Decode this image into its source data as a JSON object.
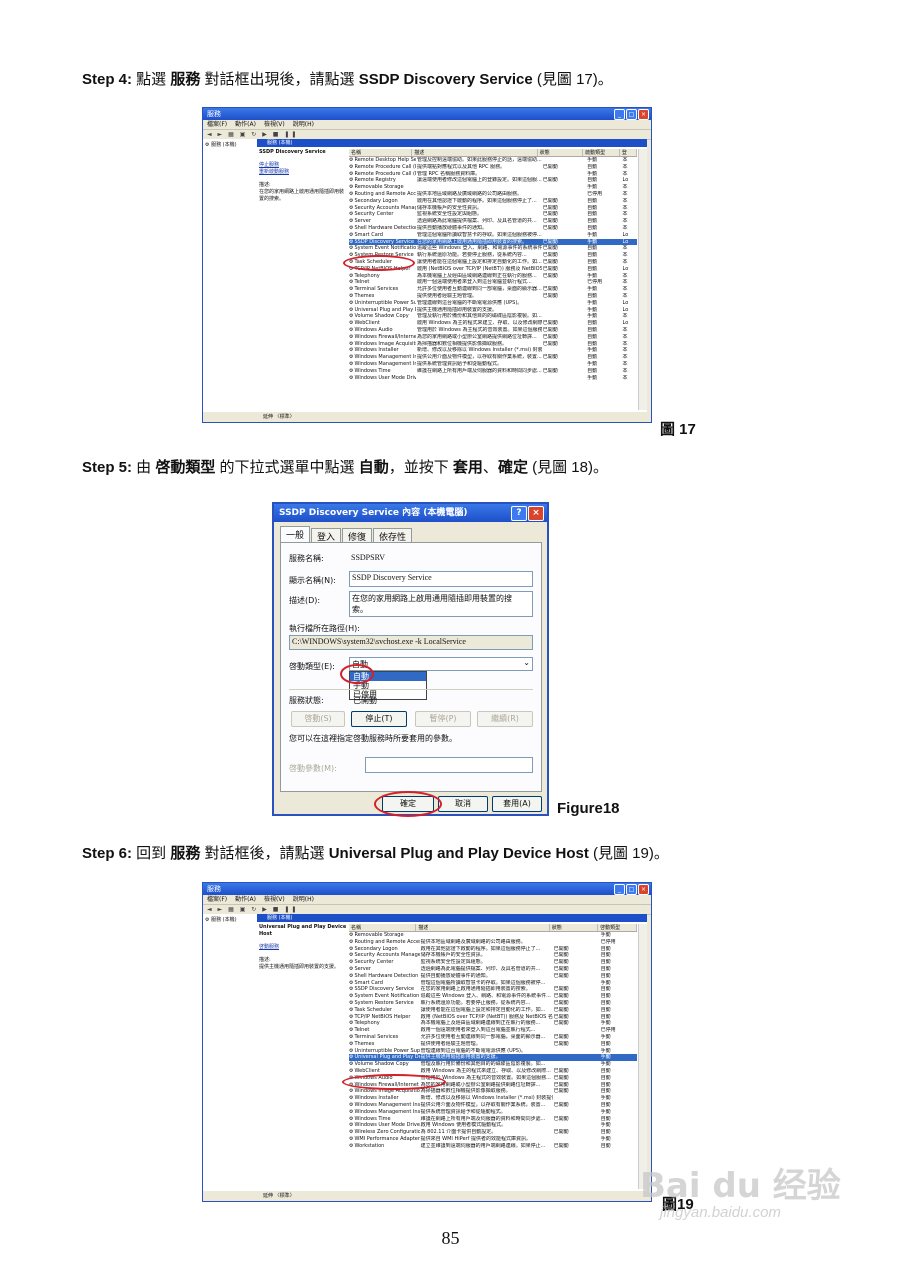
{
  "step4": {
    "prefix": "Step 4:",
    "t1": " 點選 ",
    "b1": "服務",
    "t2": " 對話框出現後，請點選 ",
    "b2": "SSDP Discovery Service",
    "t3": " (見圖 17)。"
  },
  "step5": {
    "prefix": "Step 5:",
    "t1": " 由 ",
    "b1": "啓動類型",
    "t2": " 的下拉式選單中點選 ",
    "b2": "自動",
    "t3": "，並按下 ",
    "b3": "套用",
    "t4": "、",
    "b4": "確定",
    "t5": " (見圖 18)。"
  },
  "step6": {
    "prefix": "Step 6:",
    "t1": " 回到 ",
    "b1": "服務",
    "t2": " 對話框後，請點選 ",
    "b2": "Universal Plug and Play Device Host",
    "t3": " (見圖 19)。"
  },
  "captions": {
    "fig17": "圖 17",
    "fig18": "Figure18",
    "fig19": "圖19"
  },
  "page_number": "85",
  "watermark": {
    "brand": "Bai du 经验",
    "url": "jingyan.baidu.com"
  },
  "win1": {
    "title": "服務",
    "menu": [
      "檔案(F)",
      "動作(A)",
      "檢視(V)",
      "說明(H)"
    ],
    "tree_item": "服務 (本機)",
    "pane_header": "服務 (本機)",
    "desc_title": "SSDP Discovery Service",
    "desc_links": [
      "停止服務",
      "重新啟動服務"
    ],
    "desc_label": "描述:",
    "desc_text": "在您的家用網路上啟用通用隨插即用裝置的搜索。",
    "columns": [
      "名稱",
      "描述",
      "狀態",
      "啟動類型",
      "登"
    ],
    "rows": [
      [
        "Remote Desktop Help Sess...",
        "管理及控制遠端協助。如果此服務停止的話，遠端協助...",
        "",
        "手動",
        "本"
      ],
      [
        "Remote Procedure Call (R...",
        "提供端點對應程式以及其他 RPC 服務。",
        "已開動",
        "自動",
        "本"
      ],
      [
        "Remote Procedure Call (R...",
        "管理 RPC 名稱服務資料庫。",
        "",
        "手動",
        "本"
      ],
      [
        "Remote Registry",
        "讓遠端使用者修改這個電腦上的登錄設定。如果這個服...",
        "已開動",
        "自動",
        "Lo"
      ],
      [
        "Removable Storage",
        "",
        "",
        "手動",
        "本"
      ],
      [
        "Routing and Remote Access",
        "提供本地區域網路及廣域網路的公司路由服務。",
        "",
        "已停用",
        "本"
      ],
      [
        "Secondary Logon",
        "啟用在其他認證下啟動的程序。如果這個服務停止了...",
        "已開動",
        "自動",
        "本"
      ],
      [
        "Security Accounts Manager",
        "儲存本機帳戶的安全性資訊。",
        "已開動",
        "自動",
        "本"
      ],
      [
        "Security Center",
        "監視系統安全性設定與組態。",
        "已開動",
        "自動",
        "本"
      ],
      [
        "Server",
        "透過網路為此電腦提供檔案、列印、及具名管道的共...",
        "已開動",
        "自動",
        "本"
      ],
      [
        "Shell Hardware Detection",
        "提供自動播放硬體事件的通知。",
        "已開動",
        "自動",
        "本"
      ],
      [
        "Smart Card",
        "管理這個電腦所讀取智慧卡的存取。如果這個服務被停...",
        "",
        "手動",
        "Lo"
      ],
      [
        "SSDP Discovery Service",
        "在您的家用網路上啟用通用隨插即用裝置的搜索。",
        "已開動",
        "手動",
        "Lo"
      ],
      [
        "System Event Notification",
        "追蹤這些 Windows 登入、網路、和電源事件的系統事件...",
        "已開動",
        "自動",
        "本"
      ],
      [
        "System Restore Service",
        "執行系統還原功能。若要停止服務，從系統內容...",
        "已開動",
        "自動",
        "本"
      ],
      [
        "Task Scheduler",
        "讓使用者能在這個電腦上設定和排定自動化的工作。如...",
        "已開動",
        "自動",
        "本"
      ],
      [
        "TCP/IP NetBIOS Helper",
        "啟用 (NetBIOS over TCP/IP (NetBT)) 服務及 NetBIOS 名稱...",
        "已開動",
        "自動",
        "Lo"
      ],
      [
        "Telephony",
        "為本機電腦上及經由區域網路連線到正在執行的服務...",
        "已開動",
        "手動",
        "本"
      ],
      [
        "Telnet",
        "啟用一個遠端使用者來登入到這台電腦並執行程式...",
        "",
        "已停用",
        "本"
      ],
      [
        "Terminal Services",
        "允許多位使用者互動連線到同一部電腦，桌面的顯示器...",
        "已開動",
        "手動",
        "本"
      ],
      [
        "Themes",
        "提供使用者經驗主題管理。",
        "已開動",
        "自動",
        "本"
      ],
      [
        "Uninterruptible Power Sup...",
        "管理連線到這台電腦的不斷電電源供應 (UPS)。",
        "",
        "手動",
        "Lo"
      ],
      [
        "Universal Plug and Play D...",
        "提供主機通用隨插即用裝置的支援。",
        "",
        "手動",
        "Lo"
      ],
      [
        "Volume Shadow Copy",
        "管理及執行用於備份和其他目的的磁碟區陰影複製。如...",
        "",
        "手動",
        "本"
      ],
      [
        "WebClient",
        "啟用 Windows 為主的程式來建立、存取、以及修改網際...",
        "已開動",
        "自動",
        "Lo"
      ],
      [
        "Windows Audio",
        "管理用於 Windows 為主程式的音效裝置。如果這個服務...",
        "已開動",
        "自動",
        "本"
      ],
      [
        "Windows Firewall/Internet...",
        "為您的家用網路或小型辦公室網路提供網路位址轉譯...",
        "已開動",
        "自動",
        "本"
      ],
      [
        "Windows Image Acquisiti...",
        "為掃描器和數位相機提供影像擷取服務。",
        "已開動",
        "自動",
        "本"
      ],
      [
        "Windows Installer",
        "新增、修改以及移除以 Windows Installer (*.msi) 封裝提供...",
        "",
        "手動",
        "本"
      ],
      [
        "Windows Management Ins...",
        "提供公用介面及物件模型，以存取有關作業系統，裝置...",
        "已開動",
        "自動",
        "本"
      ],
      [
        "Windows Management Ins...",
        "提供系統管理資訊給予和從驅動程式。",
        "",
        "手動",
        "本"
      ],
      [
        "Windows Time",
        "維護在網路上所有用戶端及伺服器的資料和時間同步處...",
        "已開動",
        "自動",
        "本"
      ],
      [
        "Windows User Mode Drive...",
        "",
        "",
        "手動",
        "本"
      ]
    ],
    "status_tabs": "延伸 〈標準〉"
  },
  "dialog": {
    "title": "SSDP Discovery Service 內容 (本機電腦)",
    "tabs": [
      "一般",
      "登入",
      "修復",
      "依存性"
    ],
    "service_name_label": "服務名稱:",
    "service_name": "SSDPSRV",
    "display_name_label": "顯示名稱(N):",
    "display_name": "SSDP Discovery Service",
    "description_label": "描述(D):",
    "description": "在您的家用網路上啟用通用隨插即用裝置的搜索。",
    "exe_path_label": "執行檔所在路徑(H):",
    "exe_path": "C:\\WINDOWS\\system32\\svchost.exe -k LocalService",
    "startup_label": "啓動類型(E):",
    "startup_value": "自動",
    "startup_options": [
      "自動",
      "手動",
      "已停用"
    ],
    "status_label": "服務狀態:",
    "status_value": "已開動",
    "buttons": [
      "啓動(S)",
      "停止(T)",
      "暫停(P)",
      "繼續(R)"
    ],
    "hint": "您可以在這裡指定啓動服務時所要套用的參數。",
    "params_label": "啓動參數(M):",
    "ok": "確定",
    "cancel": "取消",
    "apply": "套用(A)"
  },
  "win2": {
    "title": "服務",
    "menu": [
      "檔案(F)",
      "動作(A)",
      "檢視(V)",
      "說明(H)"
    ],
    "tree_item": "服務 (本機)",
    "pane_header": "服務 (本機)",
    "desc_title": "Universal Plug and Play Device Host",
    "desc_links": [
      "啓動服務"
    ],
    "desc_label": "描述:",
    "desc_text": "提供主機通用隨插即用裝置的支援。",
    "columns": [
      "名稱",
      "描述",
      "狀態",
      "啓動類型"
    ],
    "rows": [
      [
        "Removable Storage",
        "",
        "",
        "手動"
      ],
      [
        "Routing and Remote Access",
        "提供本地區域網路及廣域網路的公司路由服務。",
        "",
        "已停用"
      ],
      [
        "Secondary Logon",
        "啟用在其他認證下啟動的程序。如果這個服務停止了...",
        "已開動",
        "自動"
      ],
      [
        "Security Accounts Manager",
        "儲存本機帳戶的安全性資訊。",
        "已開動",
        "自動"
      ],
      [
        "Security Center",
        "監視系統安全性設定與組態。",
        "已開動",
        "自動"
      ],
      [
        "Server",
        "透過網路為此電腦提供檔案、列印、及具名管道的共...",
        "已開動",
        "自動"
      ],
      [
        "Shell Hardware Detection",
        "提供自動播放硬體事件的通知。",
        "已開動",
        "自動"
      ],
      [
        "Smart Card",
        "管理這個電腦所讀取智慧卡的存取。如果這個服務被停...",
        "",
        "手動"
      ],
      [
        "SSDP Discovery Service",
        "在您的家用網路上啟用通用隨插即用裝置的搜索。",
        "已開動",
        "自動"
      ],
      [
        "System Event Notification",
        "追蹤這些 Windows 登入、網路、和電源事件的系統事件...",
        "已開動",
        "自動"
      ],
      [
        "System Restore Service",
        "執行系統還原功能。若要停止服務，從系統內容...",
        "已開動",
        "自動"
      ],
      [
        "Task Scheduler",
        "讓使用者能在這個電腦上設定和排定自動化的工作。如...",
        "已開動",
        "自動"
      ],
      [
        "TCP/IP NetBIOS Helper",
        "啟用 (NetBIOS over TCP/IP (NetBT)) 服務及 NetBIOS 名稱...",
        "已開動",
        "自動"
      ],
      [
        "Telephony",
        "為本機電腦上及經由區域網路連線到正在執行的服務...",
        "已開動",
        "手動"
      ],
      [
        "Telnet",
        "啟用一個遠端使用者來登入到這台電腦並執行程式...",
        "",
        "已停用"
      ],
      [
        "Terminal Services",
        "允許多位使用者互動連線到同一部電腦，桌面的顯示器...",
        "已開動",
        "手動"
      ],
      [
        "Themes",
        "提供使用者經驗主題管理。",
        "已開動",
        "自動"
      ],
      [
        "Uninterruptible Power Supply",
        "管理連線到這台電腦的不斷電電源供應 (UPS)。",
        "",
        "手動"
      ],
      [
        "Universal Plug and Play Device Host",
        "提供主機通用隨插即用裝置的支援。",
        "",
        "手動"
      ],
      [
        "Volume Shadow Copy",
        "管理及執行用於備份和其他目的的磁碟區陰影複製。如...",
        "",
        "手動"
      ],
      [
        "WebClient",
        "啟用 Windows 為主的程式來建立、存取、以及修改網際...",
        "已開動",
        "自動"
      ],
      [
        "Windows Audio",
        "管理用於 Windows 為主程式的音效裝置。如果這個服務...",
        "已開動",
        "自動"
      ],
      [
        "Windows Firewall/Internet Connection ...",
        "為您的家用網路或小型辦公室網路提供網路位址轉譯...",
        "已開動",
        "自動"
      ],
      [
        "Windows Image Acquisition (WIA)",
        "為掃描器和數位相機提供影像擷取服務。",
        "已開動",
        "自動"
      ],
      [
        "Windows Installer",
        "新增、修改以及移除以 Windows Installer (*.msi) 封裝提供...",
        "",
        "手動"
      ],
      [
        "Windows Management Instrumentation",
        "提供公用介面及物件模型，以存取有關作業系統，裝置...",
        "已開動",
        "自動"
      ],
      [
        "Windows Management Instrumentation ...",
        "提供系統管理資訊給予和從驅動程式。",
        "",
        "手動"
      ],
      [
        "Windows Time",
        "維護在網路上所有用戶端及伺服器的資料和時間同步處...",
        "已開動",
        "自動"
      ],
      [
        "Windows User Mode Driver Framework",
        "啟用 Windows 使用者模式驅動程式。",
        "",
        "手動"
      ],
      [
        "Wireless Zero Configuration",
        "為 802.11 介面卡提供自動設定。",
        "已開動",
        "自動"
      ],
      [
        "WMI Performance Adapter",
        "提供來自 WMI HiPerf 提供者的效能程式庫資訊。",
        "",
        "手動"
      ],
      [
        "Workstation",
        "建立並維護到遠端伺服器的用戶端網路連線。如果停止...",
        "已開動",
        "自動"
      ]
    ],
    "status_tabs": "延伸 〈標準〉"
  }
}
